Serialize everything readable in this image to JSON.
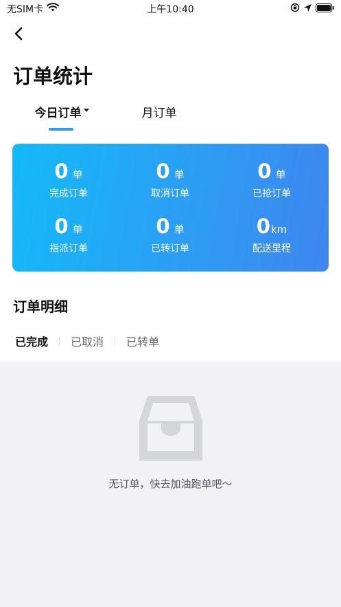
{
  "status_bar": {
    "carrier": "无SIM卡",
    "time": "上午10:40"
  },
  "header": {
    "title": "订单统计"
  },
  "tabs": [
    {
      "label": "今日订单",
      "active": true
    },
    {
      "label": "月订单",
      "active": false
    }
  ],
  "stats": [
    {
      "value": "0",
      "unit": "单",
      "label": "完成订单"
    },
    {
      "value": "0",
      "unit": "单",
      "label": "取消订单"
    },
    {
      "value": "0",
      "unit": "单",
      "label": "已抢订单"
    },
    {
      "value": "0",
      "unit": "单",
      "label": "指派订单"
    },
    {
      "value": "0",
      "unit": "单",
      "label": "已转订单"
    },
    {
      "value": "0",
      "unit": "km",
      "label": "配送里程"
    }
  ],
  "details": {
    "title": "订单明细",
    "filters": [
      {
        "label": "已完成",
        "active": true
      },
      {
        "label": "已取消",
        "active": false
      },
      {
        "label": "已转单",
        "active": false
      }
    ],
    "empty_text": "无订单，快去加油跑单吧～"
  },
  "colors": {
    "accent": "#2b9af3",
    "card_gradient_start": "#13baf8",
    "card_gradient_end": "#3f86ee",
    "empty_bg": "#f2f2f6"
  },
  "icons": [
    "wifi-icon",
    "orientation-lock-icon",
    "location-arrow-icon",
    "battery-icon",
    "back-chevron-icon",
    "empty-inbox-icon"
  ]
}
